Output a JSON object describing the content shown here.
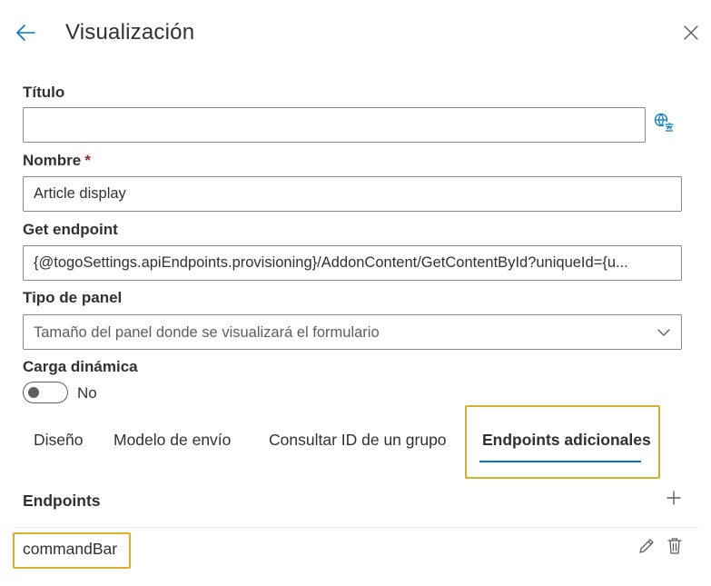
{
  "header": {
    "title": "Visualización",
    "back_icon": "arrow-left-icon",
    "close_icon": "close-icon"
  },
  "form": {
    "titulo": {
      "label": "Título",
      "value": "",
      "translate_icon": "translate-icon"
    },
    "nombre": {
      "label": "Nombre",
      "required_mark": "*",
      "value": "Article display"
    },
    "get_endpoint": {
      "label": "Get endpoint",
      "value": "{@togoSettings.apiEndpoints.provisioning}/AddonContent/GetContentById?uniqueId={u..."
    },
    "tipo_panel": {
      "label": "Tipo de panel",
      "placeholder": "Tamaño del panel donde se visualizará el formulario"
    },
    "carga_dinamica": {
      "label": "Carga dinámica",
      "toggle_state": "No",
      "on": false
    }
  },
  "tabs": [
    {
      "label": "Diseño",
      "active": false
    },
    {
      "label": "Modelo de envío",
      "active": false
    },
    {
      "label": "Consultar ID de un grupo",
      "active": false
    },
    {
      "label": "Endpoints adicionales",
      "active": true
    }
  ],
  "endpoints": {
    "section_label": "Endpoints",
    "add_icon": "plus-icon",
    "items": [
      {
        "name": "commandBar",
        "edit_icon": "pencil-icon",
        "delete_icon": "trash-icon"
      }
    ]
  },
  "colors": {
    "accent": "#0078d4",
    "highlight": "#d8b02a",
    "required": "#a4262c",
    "border": "#8a8886"
  }
}
